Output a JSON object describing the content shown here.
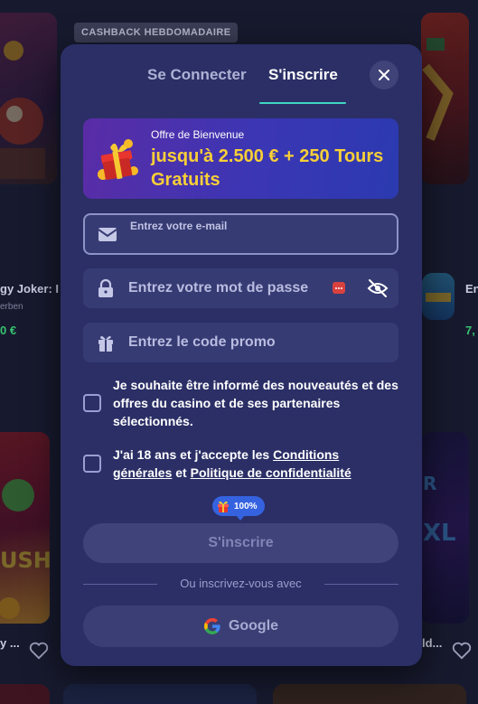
{
  "background": {
    "badge": "CASHBACK HEBDOMADAIRE",
    "game_left_title": "gy Joker: I",
    "game_left_provider": "erben",
    "game_left_price": "0 €",
    "game_right_title": "En",
    "game_right_price": "7,",
    "bottom_left_title": "y ...",
    "bottom_right_title": "ld..."
  },
  "tabs": {
    "login": "Se Connecter",
    "signup": "S'inscrire"
  },
  "promo": {
    "small": "Offre de Bienvenue",
    "big": "jusqu'à 2.500 € + 250 Tours Gratuits"
  },
  "fields": {
    "email_placeholder": "Entrez votre e-mail",
    "password_placeholder": "Entrez votre mot de passe",
    "promo_placeholder": "Entrez le code promo"
  },
  "checks": {
    "newsletter": "Je souhaite être informé des nouveautés et des offres du casino et de ses partenaires sélectionnés.",
    "terms_prefix": "J'ai 18 ans et j'accepte les ",
    "terms_link": "Conditions générales",
    "terms_and": " et ",
    "privacy_link": "Politique de confidentialité"
  },
  "progress": {
    "label": "100%",
    "value": 100
  },
  "actions": {
    "submit": "S'inscrire",
    "divider": "Ou inscrivez-vous avec",
    "google": "Google"
  },
  "icons": {
    "close": "close-icon",
    "email": "envelope-icon",
    "password": "lock-icon",
    "promo": "gift-icon",
    "eye": "eye-off-icon",
    "google": "google-icon"
  },
  "colors": {
    "modal_bg": "#2b2f66",
    "accent": "#3fd6c4",
    "promo_gold": "#f8cf37",
    "progress_blue": "#3563e0"
  }
}
